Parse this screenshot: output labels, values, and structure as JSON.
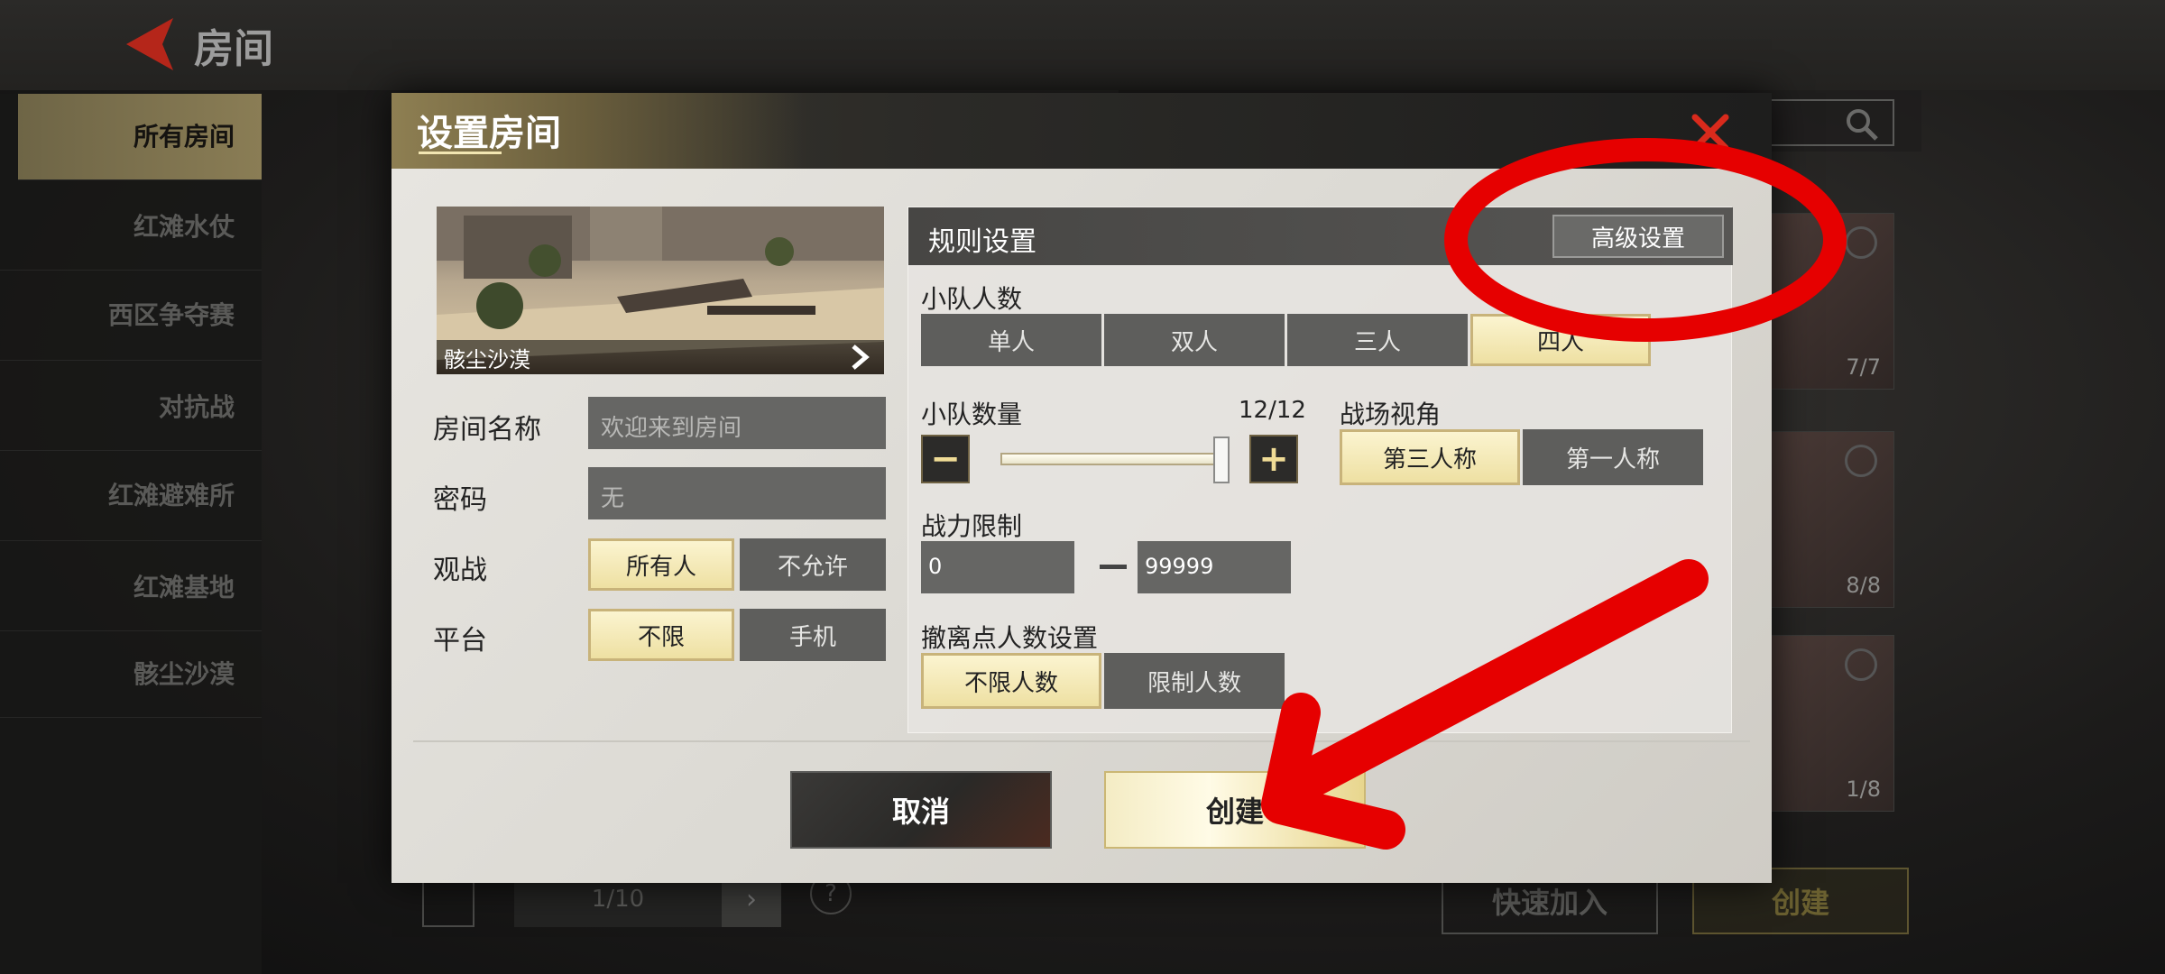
{
  "page": {
    "title": "房间"
  },
  "sidebar": {
    "items": [
      {
        "label": "所有房间",
        "active": true
      },
      {
        "label": "红滩水仗"
      },
      {
        "label": "西区争夺赛"
      },
      {
        "label": "对抗战"
      },
      {
        "label": "红滩避难所"
      },
      {
        "label": "红滩基地"
      },
      {
        "label": "骸尘沙漠"
      }
    ]
  },
  "background": {
    "room_counts": [
      "7/7",
      "8/8",
      "1/8"
    ],
    "quick_join_label": "快速加入",
    "create_label": "创建",
    "pager_text": "1/10"
  },
  "modal": {
    "title": "设置房间",
    "map": {
      "name": "骸尘沙漠"
    },
    "room_name": {
      "label": "房间名称",
      "placeholder": "欢迎来到房间"
    },
    "password": {
      "label": "密码",
      "placeholder": "无"
    },
    "spectate": {
      "label": "观战",
      "options": [
        "所有人",
        "不允许"
      ],
      "selected": "所有人"
    },
    "platform": {
      "label": "平台",
      "options": [
        "不限",
        "手机"
      ],
      "selected": "不限"
    },
    "rules": {
      "title": "规则设置",
      "advanced_label": "高级设置",
      "squad_size": {
        "label": "小队人数",
        "options": [
          "单人",
          "双人",
          "三人",
          "四人"
        ],
        "selected": "四人"
      },
      "squad_count": {
        "label": "小队数量",
        "value": 12,
        "max": 12,
        "display": "12/12"
      },
      "perspective": {
        "label": "战场视角",
        "options": [
          "第三人称",
          "第一人称"
        ],
        "selected": "第三人称"
      },
      "power_limit": {
        "label": "战力限制",
        "min": "0",
        "max": "99999"
      },
      "extraction": {
        "label": "撤离点人数设置",
        "options": [
          "不限人数",
          "限制人数"
        ],
        "selected": "不限人数"
      }
    },
    "cancel_label": "取消",
    "create_label": "创建"
  },
  "colors": {
    "accent_gold": "#eee0a2",
    "annotation_red": "#e60000",
    "close_red": "#d92a1c"
  },
  "icons": [
    "back-arrow-icon",
    "search-icon",
    "close-icon",
    "chevron-right-icon",
    "minus-icon",
    "plus-icon",
    "refresh-icon",
    "help-icon"
  ]
}
